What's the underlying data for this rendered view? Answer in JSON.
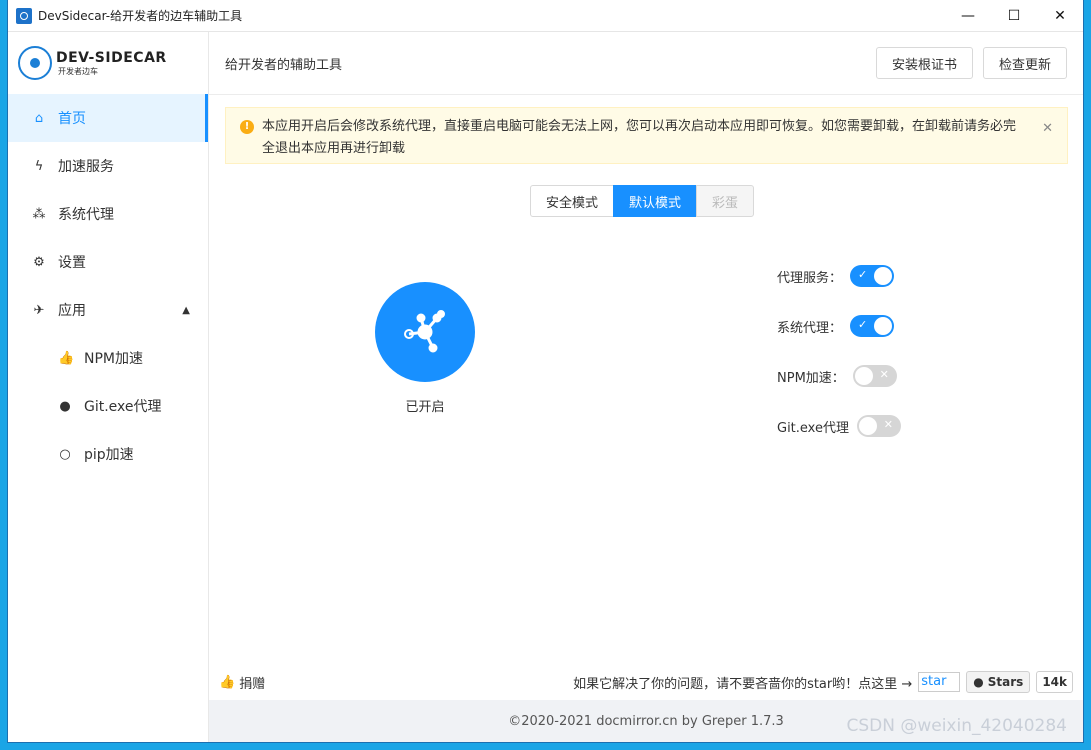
{
  "window": {
    "title": "DevSidecar-给开发者的边车辅助工具",
    "controls": {
      "minimize": "—",
      "maximize": "☐",
      "close": "✕"
    }
  },
  "logo": {
    "title": "DEV-SIDECAR",
    "subtitle": "开发者边车"
  },
  "sidebar": {
    "items": [
      {
        "label": "首页",
        "icon": "home-icon"
      },
      {
        "label": "加速服务",
        "icon": "lightning-icon"
      },
      {
        "label": "系统代理",
        "icon": "network-icon"
      },
      {
        "label": "设置",
        "icon": "gear-icon"
      },
      {
        "label": "应用",
        "icon": "rocket-icon"
      },
      {
        "label": "NPM加速",
        "icon": "thumbs-up-icon"
      },
      {
        "label": "Git.exe代理",
        "icon": "github-icon"
      },
      {
        "label": "pip加速",
        "icon": "bulb-icon"
      }
    ]
  },
  "header": {
    "title": "给开发者的辅助工具",
    "install_cert": "安装根证书",
    "check_update": "检查更新"
  },
  "alert": {
    "text": "本应用开启后会修改系统代理，直接重启电脑可能会无法上网，您可以再次启动本应用即可恢复。如您需要卸载，在卸载前请务必完全退出本应用再进行卸载"
  },
  "modes": {
    "safe": "安全模式",
    "default": "默认模式",
    "egg": "彩蛋",
    "selected": "默认模式"
  },
  "status": {
    "label": "已开启"
  },
  "switches": [
    {
      "label": "代理服务：",
      "on": true
    },
    {
      "label": "系统代理：",
      "on": true
    },
    {
      "label": "NPM加速：",
      "on": false
    },
    {
      "label": "Git.exe代理",
      "on": false
    }
  ],
  "footer": {
    "donate": "捐赠",
    "star_note": "如果它解决了你的问题，请不要吝啬你的star哟！点这里 →",
    "star_img_alt": "star",
    "github_stars_label": "Stars",
    "github_stars_count": "14k"
  },
  "copyright": "©2020-2021 docmirror.cn by Greper 1.7.3",
  "watermark": "CSDN @weixin_42040284",
  "colors": {
    "accent": "#1890ff",
    "warning": "#faad14",
    "alert_bg": "#fffbe6"
  }
}
